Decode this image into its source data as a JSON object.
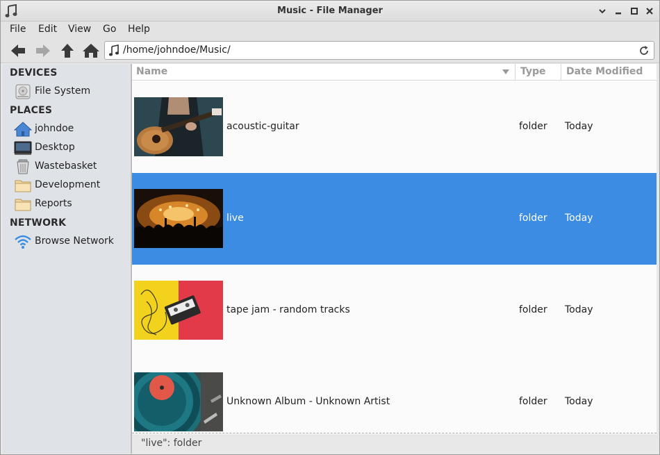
{
  "window": {
    "title": "Music - File Manager"
  },
  "menu": [
    "File",
    "Edit",
    "View",
    "Go",
    "Help"
  ],
  "toolbar": {
    "back_icon": "arrow-left-icon",
    "forward_icon": "arrow-right-icon",
    "up_icon": "arrow-up-icon",
    "home_icon": "home-icon",
    "location": "/home/johndoe/Music/",
    "reload_icon": "reload-icon"
  },
  "sidebar": {
    "sections": [
      {
        "heading": "DEVICES",
        "items": [
          {
            "label": "File System",
            "icon": "hard-drive-icon"
          }
        ]
      },
      {
        "heading": "PLACES",
        "items": [
          {
            "label": "johndoe",
            "icon": "home-folder-icon"
          },
          {
            "label": "Desktop",
            "icon": "desktop-icon"
          },
          {
            "label": "Wastebasket",
            "icon": "trash-icon"
          },
          {
            "label": "Development",
            "icon": "folder-icon"
          },
          {
            "label": "Reports",
            "icon": "folder-icon"
          }
        ]
      },
      {
        "heading": "NETWORK",
        "items": [
          {
            "label": "Browse Network",
            "icon": "wifi-icon"
          }
        ]
      }
    ]
  },
  "list": {
    "columns": [
      "Name",
      "Type",
      "Date Modified"
    ],
    "sort_column": "Name",
    "rows": [
      {
        "name": "acoustic-guitar",
        "type": "folder",
        "modified": "Today",
        "thumbnail": "guitar-photo",
        "selected": false
      },
      {
        "name": "live",
        "type": "folder",
        "modified": "Today",
        "thumbnail": "concert-photo",
        "selected": true
      },
      {
        "name": "tape jam - random tracks",
        "type": "folder",
        "modified": "Today",
        "thumbnail": "cassette-photo",
        "selected": false
      },
      {
        "name": "Unknown Album - Unknown Artist",
        "type": "folder",
        "modified": "Today",
        "thumbnail": "vinyl-photo",
        "selected": false
      }
    ]
  },
  "status": "\"live\": folder",
  "colors": {
    "selection": "#3b8ce2",
    "sidebar": "#dfe3e8"
  }
}
